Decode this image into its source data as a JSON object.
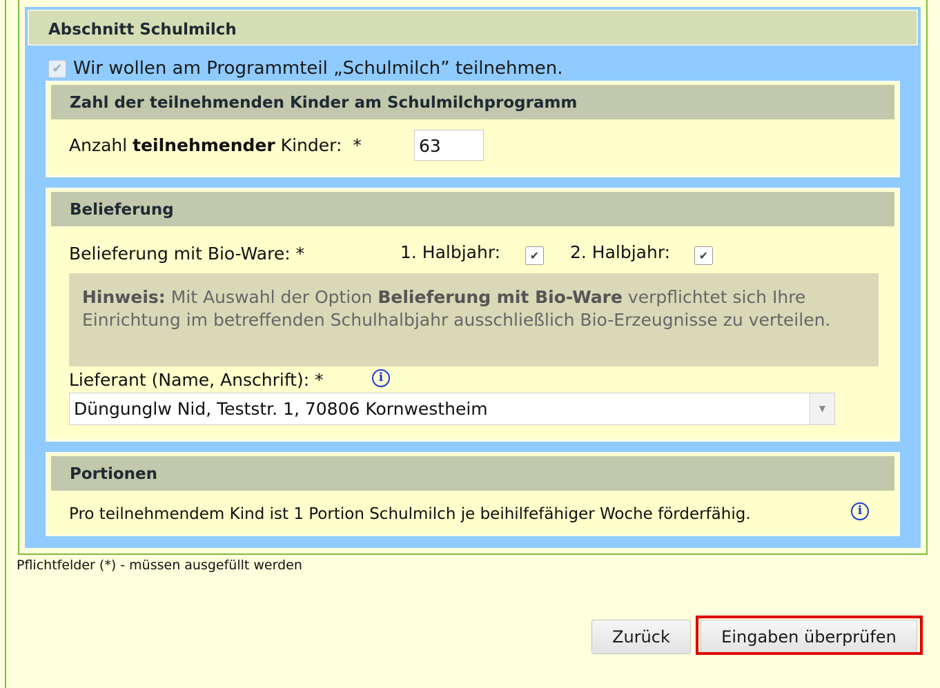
{
  "section": {
    "title": "Abschnitt Schulmilch"
  },
  "participate": {
    "label": "Wir wollen am Programmteil „Schulmilch” teilnehmen.",
    "checked": true
  },
  "children_panel": {
    "title": "Zahl der teilnehmenden Kinder am Schulmilchprogramm",
    "label_pre": "Anzahl ",
    "label_bold": "teilnehmender",
    "label_post": " Kinder:  *",
    "value": "63"
  },
  "delivery_panel": {
    "title": "Belieferung",
    "bio_label": "Belieferung mit Bio-Ware: *",
    "half1_label": "1. Halbjahr:",
    "half1_checked": true,
    "half2_label": "2. Halbjahr:",
    "half2_checked": true,
    "hint": {
      "title": "Hinweis:",
      "text_pre": " Mit Auswahl der Option ",
      "text_bold": "Belieferung mit Bio-Ware",
      "text_post": " verpflichtet sich Ihre Einrichtung im betreffenden Schulhalbjahr ausschließlich Bio-Erzeugnisse zu verteilen."
    },
    "supplier_label": "Lieferant (Name, Anschrift): *",
    "supplier_value": "Düngunglw Nid, Teststr. 1, 70806 Kornwestheim"
  },
  "portions_panel": {
    "title": "Portionen",
    "text": "Pro teilnehmendem Kind ist 1 Portion Schulmilch je beihilfefähiger Woche förderfähig."
  },
  "footnote": "Pflichtfelder (*) - müssen ausgefüllt werden",
  "buttons": {
    "back": "Zurück",
    "check": "Eingaben überprüfen"
  },
  "icons": {
    "info": "info-icon",
    "checkmark": "checkmark-icon",
    "dropdown": "chevron-down-icon"
  },
  "colors": {
    "highlight": "#e00000",
    "info": "#1a3ad8",
    "panel_blue": "#8fcbff"
  }
}
